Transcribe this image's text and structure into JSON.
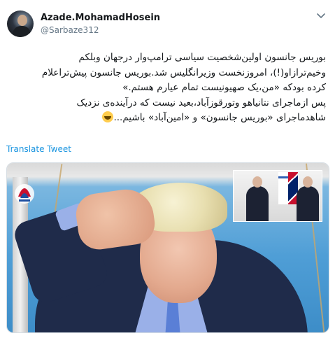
{
  "author": {
    "name": "Azade.MohamadHosein",
    "handle": "@Sarbaze312"
  },
  "tweet": {
    "lines": [
      "بوریس جانسون اولین‌شخصیت سیاسی ترامپ‌وار درجهان وبلکم",
      "وخیم‌ترازاو(!)، امروزنخست وزیرانگلیس شد.بوریس جانسون پیش‌تراعلام",
      "کرده بودکه «من،یک صهیونیست تمام عیارم هستم.»",
      "پس ازماجرای نتانیاهو وتورقوزآباد،بعید نیست که درآینده‌ی نزدیک",
      "شاهدماجرای «بوریس جانسون» و «امین‌آباد» باشیم..."
    ],
    "emoji": "grinning-face-emoji"
  },
  "translate_label": "Translate Tweet",
  "media": {
    "icons": [
      "news-agency-logo",
      "chevron-down-icon"
    ]
  }
}
